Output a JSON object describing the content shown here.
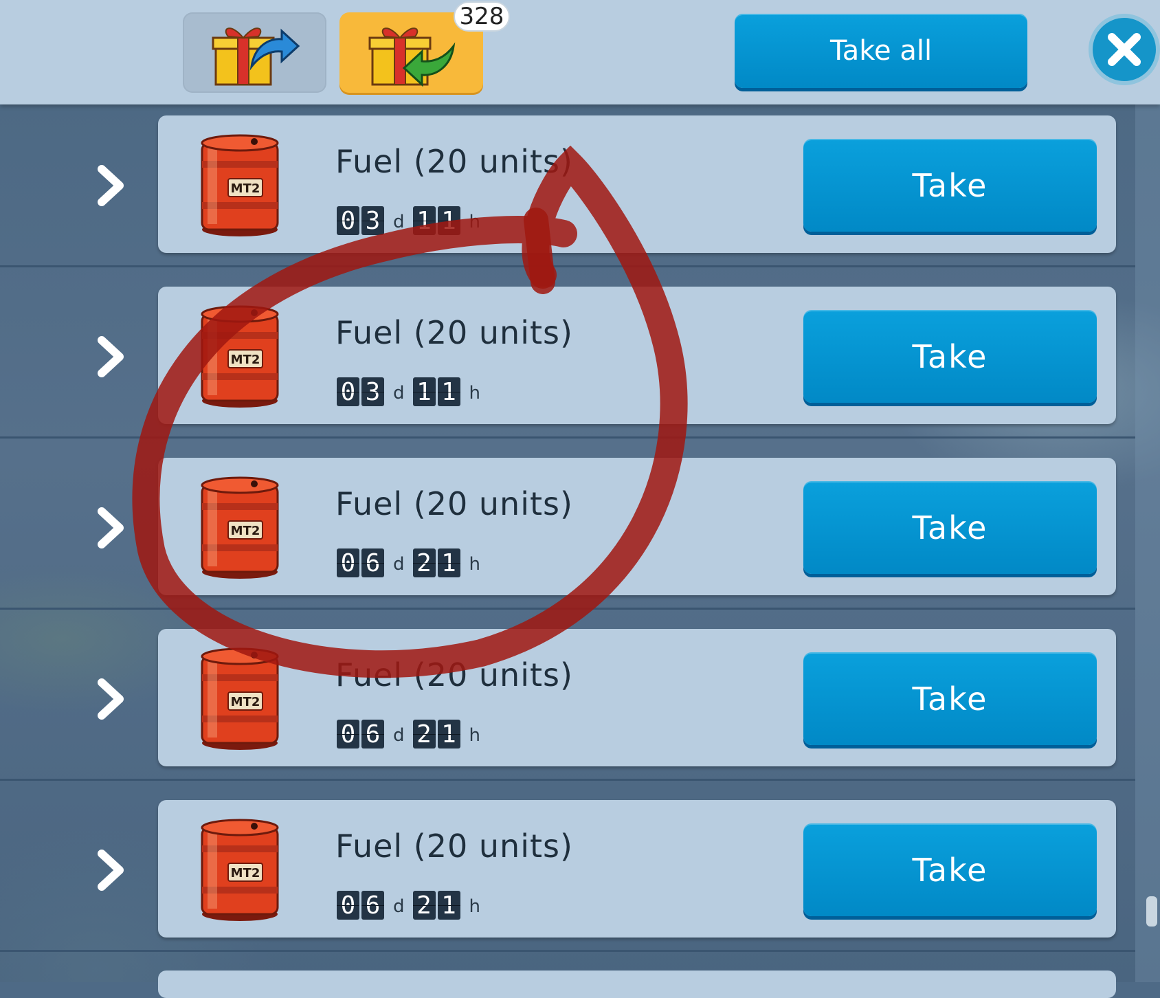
{
  "header": {
    "tabs": [
      {
        "name": "send-gifts",
        "icon": "gift-send-icon",
        "active": false
      },
      {
        "name": "received-gifts",
        "icon": "gift-receive-icon",
        "active": true
      }
    ],
    "received_count": "328",
    "take_all_label": "Take all",
    "close_icon": "close-icon"
  },
  "gifts": [
    {
      "title": "Fuel (20 units)",
      "days": [
        "0",
        "3"
      ],
      "hours": [
        "1",
        "1"
      ],
      "day_unit": "d",
      "hour_unit": "h",
      "take_label": "Take",
      "barrel_label": "MT2"
    },
    {
      "title": "Fuel (20 units)",
      "days": [
        "0",
        "3"
      ],
      "hours": [
        "1",
        "1"
      ],
      "day_unit": "d",
      "hour_unit": "h",
      "take_label": "Take",
      "barrel_label": "MT2"
    },
    {
      "title": "Fuel (20 units)",
      "days": [
        "0",
        "6"
      ],
      "hours": [
        "2",
        "1"
      ],
      "day_unit": "d",
      "hour_unit": "h",
      "take_label": "Take",
      "barrel_label": "MT2"
    },
    {
      "title": "Fuel (20 units)",
      "days": [
        "0",
        "6"
      ],
      "hours": [
        "2",
        "1"
      ],
      "day_unit": "d",
      "hour_unit": "h",
      "take_label": "Take",
      "barrel_label": "MT2"
    },
    {
      "title": "Fuel (20 units)",
      "days": [
        "0",
        "6"
      ],
      "hours": [
        "2",
        "1"
      ],
      "day_unit": "d",
      "hour_unit": "h",
      "take_label": "Take",
      "barrel_label": "MT2"
    }
  ],
  "colors": {
    "accent": "#0189c6",
    "active_tab": "#f8b93a",
    "annotation": "#a01810"
  }
}
